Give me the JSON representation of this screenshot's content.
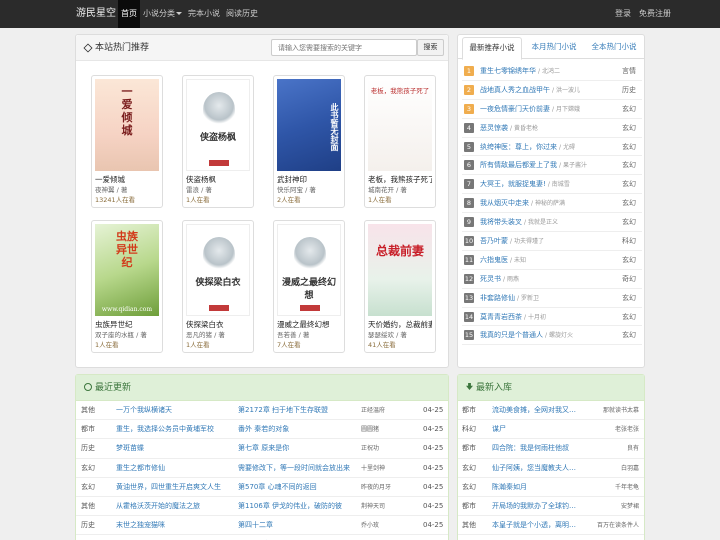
{
  "navbar": {
    "brand": "游民星空",
    "items": [
      {
        "label": "首页",
        "active": true
      },
      {
        "label": "小说分类",
        "dropdown": true
      },
      {
        "label": "完本小说"
      },
      {
        "label": "阅读历史"
      }
    ],
    "login": "登录",
    "register": "免费注册"
  },
  "hot": {
    "title": "本站热门推荐",
    "search_placeholder": "请输入您需要搜索的关键字",
    "search_button": "搜索",
    "books": [
      {
        "title": "一爱倾城",
        "author": "夜神翼 / 著",
        "views": "13241人在看",
        "cover_text": "一爱倾城",
        "cover_style": "pink"
      },
      {
        "title": "侠盗杨枫",
        "author": "雷浪 / 著",
        "views": "1人在看",
        "cover_text": "侠盗杨枫",
        "cover_style": "placeholder"
      },
      {
        "title": "武封神印",
        "author": "快乐阿宝 / 著",
        "views": "2人在看",
        "cover_text": "此书暂无封面",
        "cover_style": "blue"
      },
      {
        "title": "老板，我熊孩子死了",
        "author": "城南花开 / 著",
        "views": "1人在看",
        "cover_text": "老板，我熊孩子死了",
        "cover_style": "sketch"
      },
      {
        "title": "虫族异世纪",
        "author": "双子座的水瓶 / 著",
        "views": "1人在看",
        "cover_text": "虫族异世纪",
        "cover_style": "green",
        "watermark": "www.qidian.com"
      },
      {
        "title": "侠探梁白衣",
        "author": "恶凡的猪 / 著",
        "views": "1人在看",
        "cover_text": "侠探梁白衣",
        "cover_style": "placeholder"
      },
      {
        "title": "漫威之最终幻想",
        "author": "吾若善 / 著",
        "views": "7人在看",
        "cover_text": "漫威之最终幻想",
        "cover_style": "placeholder"
      },
      {
        "title": "天价婚约，总裁前妻",
        "author": "瑟瑟绥欢 / 著",
        "views": "41人在看",
        "cover_text": "总裁前妻",
        "cover_style": "romance"
      }
    ]
  },
  "ranks": {
    "tabs": [
      "最新推荐小说",
      "本月热门小说",
      "全本热门小说"
    ],
    "items": [
      {
        "n": "1",
        "name": "重生七零锦绣年华",
        "author": "北鸿二",
        "cat": "言情"
      },
      {
        "n": "2",
        "name": "战地真人秀之血战甲午",
        "author": "洪一波儿",
        "cat": "历史"
      },
      {
        "n": "3",
        "name": "一夜危情豪门天价前妻",
        "author": "月下嫦娥",
        "cat": "玄幻"
      },
      {
        "n": "4",
        "name": "恶灵惊袭",
        "author": "黄昏老枪",
        "cat": "玄幻"
      },
      {
        "n": "5",
        "name": "纨绔神医：尊上，你过来",
        "author": "尤碍",
        "cat": "玄幻"
      },
      {
        "n": "6",
        "name": "所有情敌最后都爱上了我",
        "author": "果子酱汁",
        "cat": "玄幻"
      },
      {
        "n": "7",
        "name": "大冥王，就服捉鬼妻!",
        "author": "南城雪",
        "cat": "玄幻"
      },
      {
        "n": "8",
        "name": "我从烟灭中走来",
        "author": "神秘的萨满",
        "cat": "玄幻"
      },
      {
        "n": "9",
        "name": "我将带头装叉",
        "author": "我就是正义",
        "cat": "玄幻"
      },
      {
        "n": "10",
        "name": "吾乃叶蒙",
        "author": "功夫得瑾了",
        "cat": "科幻"
      },
      {
        "n": "11",
        "name": "六指鬼医",
        "author": "未知",
        "cat": "玄幻"
      },
      {
        "n": "12",
        "name": "死灵书",
        "author": "雨燕",
        "cat": "奇幻"
      },
      {
        "n": "13",
        "name": "非套路修仙",
        "author": "罗新卫",
        "cat": "玄幻"
      },
      {
        "n": "14",
        "name": "莫青青岩西茶",
        "author": "十月初",
        "cat": "玄幻"
      },
      {
        "n": "15",
        "name": "我真的只是个普通人",
        "author": "螺旋灯火",
        "cat": "玄幻"
      }
    ]
  },
  "recent": {
    "title": "最近更新",
    "rows": [
      {
        "cat": "其他",
        "name": "一万个我纵横诸天",
        "chapter": "第2172章 扫于地下生存联盟",
        "author": "正经温府",
        "date": "04-25"
      },
      {
        "cat": "都市",
        "name": "重生，我选择公务员中黄埔军校",
        "chapter": "番外 秦若的对象",
        "author": "圆圆猪",
        "date": "04-25"
      },
      {
        "cat": "历史",
        "name": "梦斑苗蝶",
        "chapter": "第七章 原来是你",
        "author": "正祝功",
        "date": "04-25"
      },
      {
        "cat": "玄幻",
        "name": "重生之都市修仙",
        "chapter": "需要修改下，等一段时间就会放出来",
        "author": "十里剑神",
        "date": "04-25"
      },
      {
        "cat": "玄幻",
        "name": "黄油世界，四世重生开启爽文人生",
        "chapter": "第570章 心魂不同的返回",
        "author": "昨夜的月牙",
        "date": "04-25"
      },
      {
        "cat": "其他",
        "name": "从霍格沃茨开始的魔法之旅",
        "chapter": "第1106章 伊戈的伟业，破防的彼",
        "author": "荆神天司",
        "date": "04-25"
      },
      {
        "cat": "历史",
        "name": "末世之独宠猫咪",
        "chapter": "第四十二章",
        "author": "乔小玫",
        "date": "04-25"
      },
      {
        "cat": "玄幻",
        "name": "正义的使命",
        "chapter": "第1128章 因果报应",
        "author": "膨胀小藏",
        "date": "04-25"
      }
    ]
  },
  "newin": {
    "title": "最新入库",
    "rows": [
      {
        "cat": "都市",
        "name": "流动美食摊，全网对我又…",
        "author": "那就读书太慕"
      },
      {
        "cat": "科幻",
        "name": "谋尸",
        "author": "老张老张"
      },
      {
        "cat": "都市",
        "name": "四合院：我是何雨柱他叔",
        "author": "良有"
      },
      {
        "cat": "玄幻",
        "name": "仙子阿姨，您当魔教夫人…",
        "author": "白羽嘉"
      },
      {
        "cat": "玄幻",
        "name": "陈瀚秦如月",
        "author": "千年老龟"
      },
      {
        "cat": "都市",
        "name": "开局场的我默办了全球钓…",
        "author": "安梦裙"
      },
      {
        "cat": "其他",
        "name": "本皇子就是个小透，离明…",
        "author": "百万在读条件人"
      },
      {
        "cat": "玄幻",
        "name": "渣父子查出的，直富宽路",
        "author": "满天迷星"
      }
    ]
  }
}
